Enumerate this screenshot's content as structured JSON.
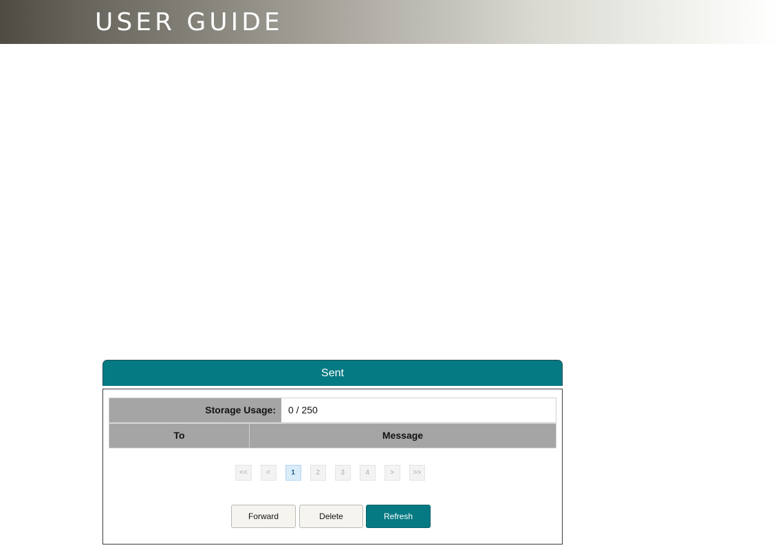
{
  "banner": {
    "title": "USER GUIDE"
  },
  "panel": {
    "title": "Sent",
    "storage": {
      "label": "Storage Usage:",
      "value": "0 / 250"
    },
    "columns": {
      "to": "To",
      "message": "Message"
    },
    "pagination": {
      "first": "<<",
      "prev": "<",
      "pages": [
        "1",
        "2",
        "3",
        "4"
      ],
      "next": ">",
      "last": ">>",
      "current": "1"
    },
    "buttons": {
      "forward": "Forward",
      "delete": "Delete",
      "refresh": "Refresh"
    }
  },
  "colors": {
    "accent": "#067a83",
    "header_gray": "#a5a5a5",
    "button_light": "#f5f4ee"
  }
}
